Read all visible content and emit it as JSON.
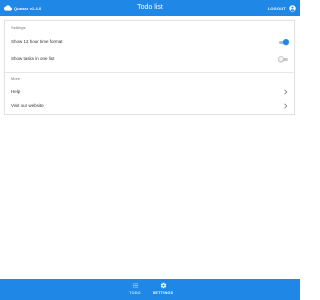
{
  "colors": {
    "primary": "#1f87e6",
    "toggle_on_track": "#8fc3f3",
    "section_header": "#7a7a7a"
  },
  "header": {
    "app_version": "Quasar v1.4.0",
    "title": "Todo list",
    "logout_label": "LOGOUT",
    "left_icon": "cloud-icon",
    "right_icon": "account-icon"
  },
  "settings": {
    "section_title": "Settings",
    "items": [
      {
        "label": "Show 12 hour time format",
        "enabled": true
      },
      {
        "label": "Show tasks in one list",
        "enabled": false
      }
    ]
  },
  "more": {
    "section_title": "More",
    "items": [
      {
        "label": "Help",
        "icon": "chevron-right-icon"
      },
      {
        "label": "Visit our website",
        "icon": "chevron-right-icon"
      }
    ]
  },
  "bottom_nav": {
    "items": [
      {
        "label": "TODO",
        "icon": "list-icon",
        "active": false
      },
      {
        "label": "SETTINGS",
        "icon": "gear-icon",
        "active": true
      }
    ]
  }
}
